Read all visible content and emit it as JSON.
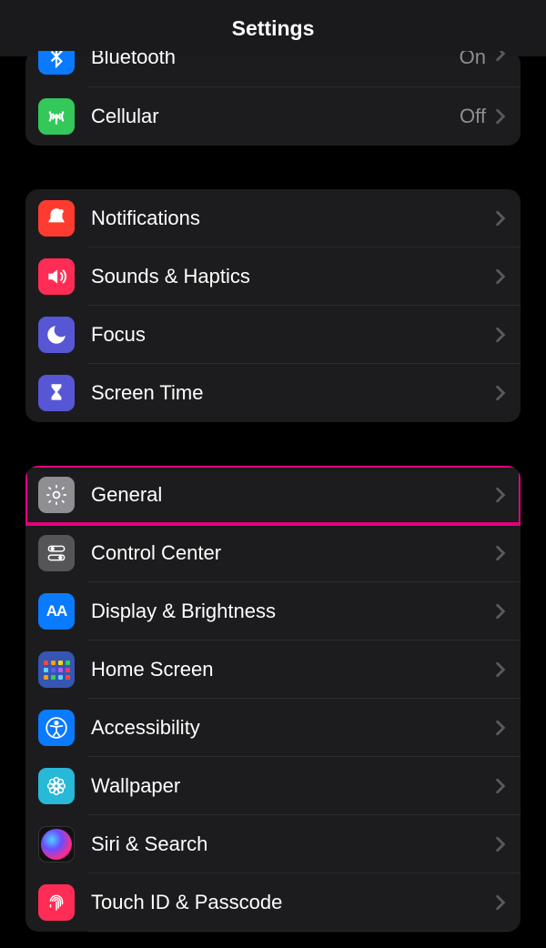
{
  "header": {
    "title": "Settings"
  },
  "groups": [
    {
      "id": "connectivity",
      "items": [
        {
          "id": "bluetooth",
          "label": "Bluetooth",
          "value": "On",
          "icon": "bluetooth-icon",
          "bg": "blue",
          "partial": true
        },
        {
          "id": "cellular",
          "label": "Cellular",
          "value": "Off",
          "icon": "antenna-icon",
          "bg": "green"
        }
      ]
    },
    {
      "id": "notifications-group",
      "items": [
        {
          "id": "notifications",
          "label": "Notifications",
          "icon": "bell-icon",
          "bg": "red"
        },
        {
          "id": "sounds-haptics",
          "label": "Sounds & Haptics",
          "icon": "speaker-icon",
          "bg": "red"
        },
        {
          "id": "focus",
          "label": "Focus",
          "icon": "moon-icon",
          "bg": "purple"
        },
        {
          "id": "screen-time",
          "label": "Screen Time",
          "icon": "hourglass-icon",
          "bg": "purple"
        }
      ]
    },
    {
      "id": "general-group",
      "items": [
        {
          "id": "general",
          "label": "General",
          "icon": "gear-icon",
          "bg": "gray",
          "highlighted": true
        },
        {
          "id": "control-center",
          "label": "Control Center",
          "icon": "toggles-icon",
          "bg": "darkgray"
        },
        {
          "id": "display-brightness",
          "label": "Display & Brightness",
          "icon": "text-size-icon",
          "bg": "blue"
        },
        {
          "id": "home-screen",
          "label": "Home Screen",
          "icon": "apps-grid-icon",
          "bg": "home"
        },
        {
          "id": "accessibility",
          "label": "Accessibility",
          "icon": "accessibility-icon",
          "bg": "blue"
        },
        {
          "id": "wallpaper",
          "label": "Wallpaper",
          "icon": "flower-icon",
          "bg": "cyan"
        },
        {
          "id": "siri-search",
          "label": "Siri & Search",
          "icon": "siri-icon",
          "bg": "black"
        },
        {
          "id": "touchid-passcode",
          "label": "Touch ID & Passcode",
          "icon": "fingerprint-icon",
          "bg": "red"
        }
      ]
    }
  ],
  "highlight_color": "#e6007e"
}
